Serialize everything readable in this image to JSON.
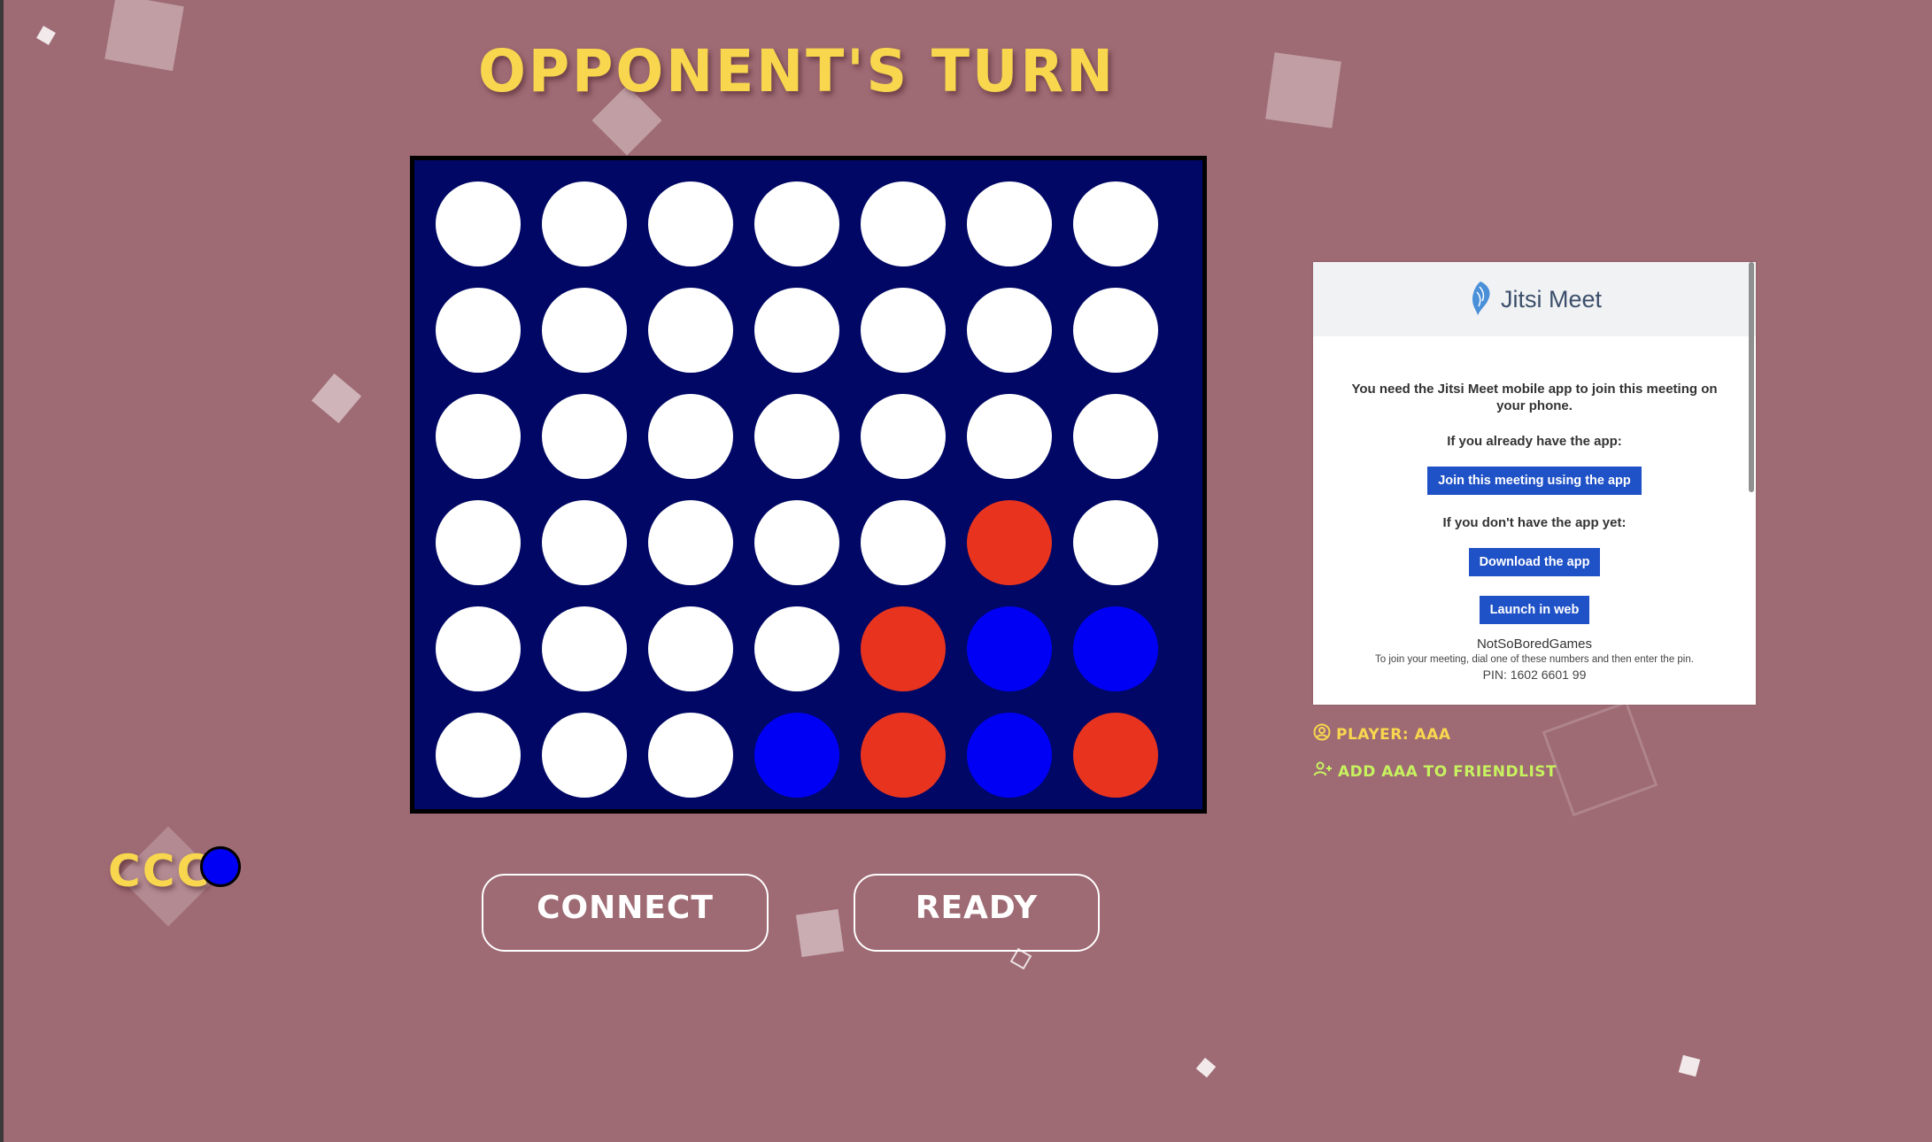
{
  "game": {
    "status_title": "Opponent's Turn",
    "board": [
      [
        "empty",
        "empty",
        "empty",
        "empty",
        "empty",
        "empty",
        "empty"
      ],
      [
        "empty",
        "empty",
        "empty",
        "empty",
        "empty",
        "empty",
        "empty"
      ],
      [
        "empty",
        "empty",
        "empty",
        "empty",
        "empty",
        "empty",
        "empty"
      ],
      [
        "empty",
        "empty",
        "empty",
        "empty",
        "empty",
        "red",
        "empty"
      ],
      [
        "empty",
        "empty",
        "empty",
        "empty",
        "red",
        "blue",
        "blue"
      ],
      [
        "empty",
        "empty",
        "empty",
        "blue",
        "red",
        "blue",
        "red"
      ]
    ],
    "colors": {
      "background": "#9e6a73",
      "board": "#000764",
      "red_disc": "#e8341e",
      "blue_disc": "#0000f5",
      "title": "#f8d74f",
      "friend_link": "#c7f25f"
    }
  },
  "local_player": {
    "name": "CCC",
    "disc_color": "blue"
  },
  "controls": {
    "connect_label": "Connect",
    "ready_label": "Ready"
  },
  "jitsi": {
    "brand": "Jitsi Meet",
    "need_app_text": "You need the Jitsi Meet mobile app to join this meeting on your phone.",
    "have_app_text": "If you already have the app:",
    "join_button": "Join this meeting using the app",
    "no_app_text": "If you don't have the app yet:",
    "download_button": "Download the app",
    "launch_button": "Launch in web",
    "meeting_name": "NotSoBoredGames",
    "dial_text": "To join your meeting, dial one of these numbers and then enter the pin.",
    "pin_text": "PIN: 1602 6601 99"
  },
  "sidebar": {
    "player_label": "Player: AAA",
    "add_friend_label": "Add AAA to Friendlist",
    "player_icon": "user-circle-icon",
    "add_friend_icon": "user-plus-icon"
  }
}
